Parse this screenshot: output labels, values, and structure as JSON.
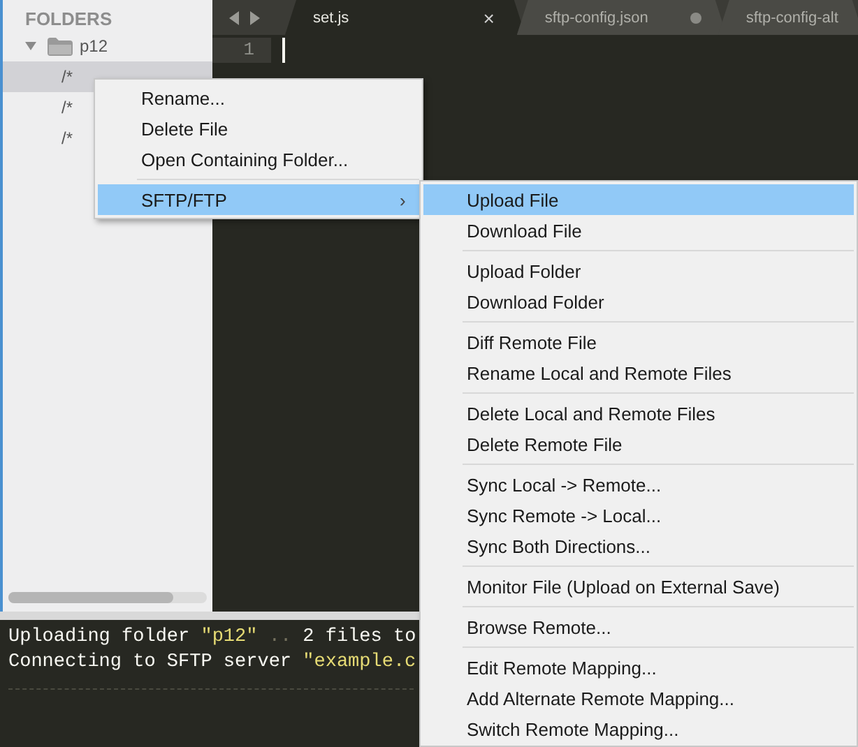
{
  "sidebar": {
    "header": "FOLDERS",
    "tree": [
      {
        "label": "p12",
        "expanded": true,
        "selected": false,
        "children": [
          {
            "label": "/*",
            "selected": true
          },
          {
            "label": "/*",
            "selected": false
          },
          {
            "label": "/*",
            "selected": false
          }
        ]
      }
    ]
  },
  "tabs": [
    {
      "label": "set.js",
      "selected": true,
      "close": "×",
      "dirty": false
    },
    {
      "label": "sftp-config.json",
      "selected": false,
      "dirty": true
    },
    {
      "label": "sftp-config-alt",
      "selected": false,
      "dirty": false
    }
  ],
  "editor": {
    "line_numbers": [
      "1"
    ]
  },
  "console": {
    "lines": [
      [
        {
          "kind": "plain",
          "text": "Uploading folder "
        },
        {
          "kind": "string",
          "text": "\"p12\""
        },
        {
          "kind": "dim",
          "text": " .. "
        },
        {
          "kind": "plain",
          "text": "2 files to"
        }
      ],
      [
        {
          "kind": "plain",
          "text": "Connecting to SFTP server "
        },
        {
          "kind": "string",
          "text": "\"example.c"
        }
      ]
    ]
  },
  "context_menu": {
    "groups": [
      [
        {
          "label": "Rename...",
          "selected": false
        },
        {
          "label": "Delete File",
          "selected": false
        },
        {
          "label": "Open Containing Folder...",
          "selected": false
        }
      ],
      [
        {
          "label": "SFTP/FTP",
          "selected": true,
          "submenu_arrow": "›"
        }
      ]
    ]
  },
  "submenu": {
    "groups": [
      [
        {
          "label": "Upload File",
          "selected": true
        },
        {
          "label": "Download File",
          "selected": false
        }
      ],
      [
        {
          "label": "Upload Folder",
          "selected": false
        },
        {
          "label": "Download Folder",
          "selected": false
        }
      ],
      [
        {
          "label": "Diff Remote File",
          "selected": false
        },
        {
          "label": "Rename Local and Remote Files",
          "selected": false
        }
      ],
      [
        {
          "label": "Delete Local and Remote Files",
          "selected": false
        },
        {
          "label": "Delete Remote File",
          "selected": false
        }
      ],
      [
        {
          "label": "Sync Local -> Remote...",
          "selected": false
        },
        {
          "label": "Sync Remote -> Local...",
          "selected": false
        },
        {
          "label": "Sync Both Directions...",
          "selected": false
        }
      ],
      [
        {
          "label": "Monitor File (Upload on External Save)",
          "selected": false
        }
      ],
      [
        {
          "label": "Browse Remote...",
          "selected": false
        }
      ],
      [
        {
          "label": "Edit Remote Mapping...",
          "selected": false
        },
        {
          "label": "Add Alternate Remote Mapping...",
          "selected": false
        },
        {
          "label": "Switch Remote Mapping...",
          "selected": false
        }
      ]
    ]
  }
}
